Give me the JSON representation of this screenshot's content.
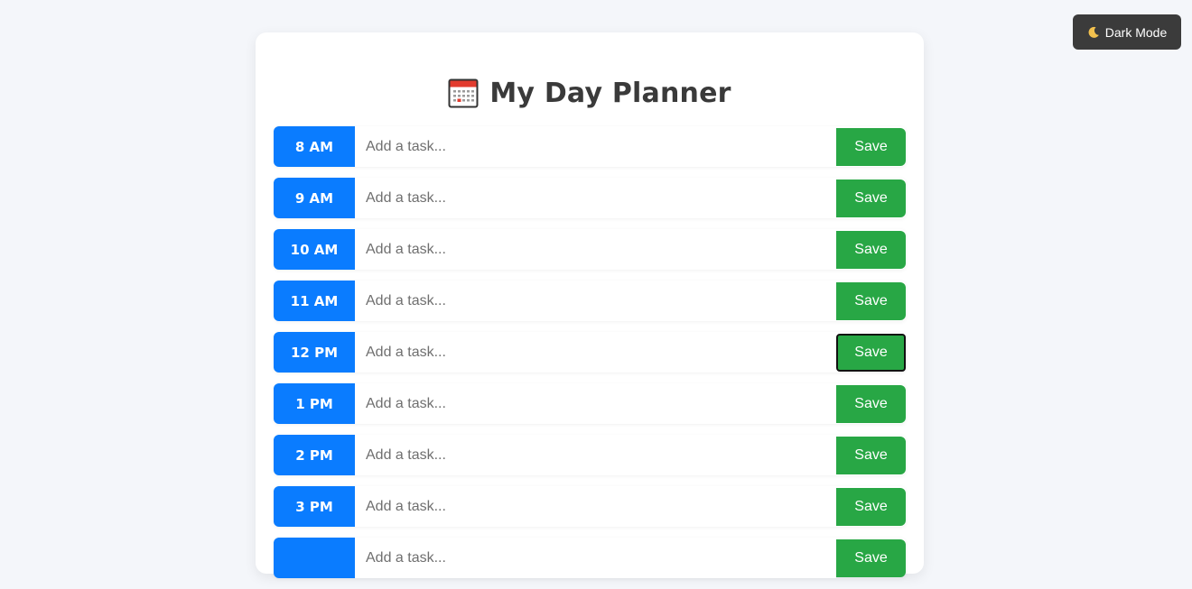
{
  "theme_toggle": {
    "label": "Dark Mode",
    "icon": "moon-icon"
  },
  "header": {
    "title": "My Day Planner",
    "icon": "calendar-icon"
  },
  "task_placeholder": "Add a task...",
  "save_label": "Save",
  "colors": {
    "hour_label_bg": "#0a7cff",
    "save_bg": "#28a745",
    "toggle_bg": "#3b3b3b",
    "page_bg": "#f4f6fa"
  },
  "rows": [
    {
      "hour": "8 AM",
      "task": ""
    },
    {
      "hour": "9 AM",
      "task": ""
    },
    {
      "hour": "10 AM",
      "task": ""
    },
    {
      "hour": "11 AM",
      "task": ""
    },
    {
      "hour": "12 PM",
      "task": "",
      "save_focused": true
    },
    {
      "hour": "1 PM",
      "task": ""
    },
    {
      "hour": "2 PM",
      "task": ""
    },
    {
      "hour": "3 PM",
      "task": ""
    },
    {
      "hour": "",
      "task": ""
    }
  ]
}
